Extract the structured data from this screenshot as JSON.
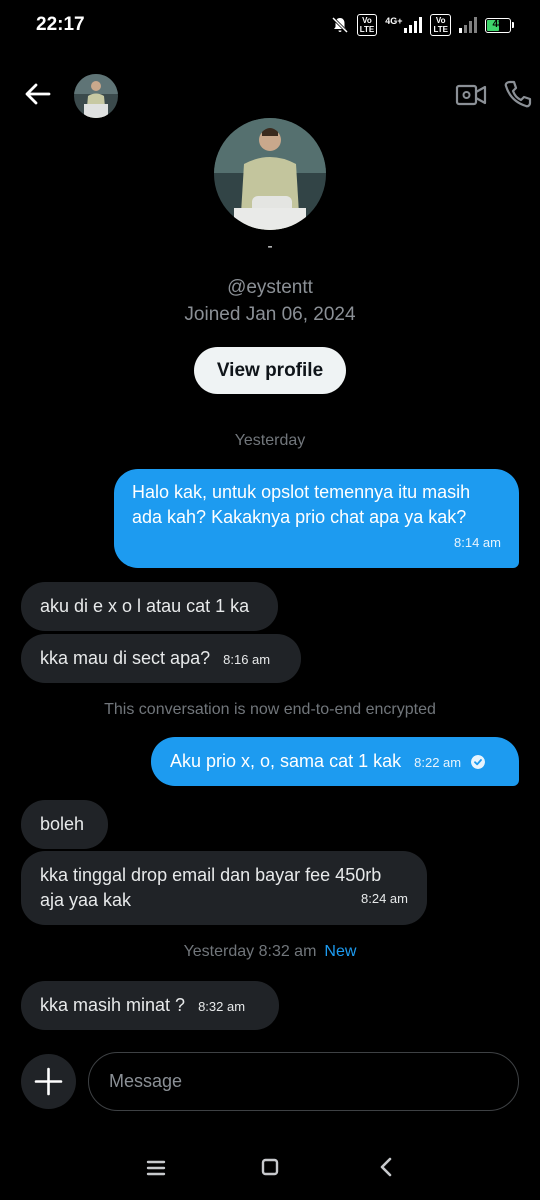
{
  "status_bar": {
    "time": "22:17",
    "network_label": "4G+",
    "volte_label": "Vo\nLTE",
    "battery_percent": "48",
    "battery_level": 0.48
  },
  "header": {
    "back_icon": "arrow-left-icon",
    "video_icon": "video-call-icon",
    "call_icon": "phone-icon"
  },
  "profile": {
    "dash": "-",
    "handle": "@eystentt",
    "joined": "Joined Jan 06, 2024",
    "view_profile_label": "View profile"
  },
  "conversation": {
    "sep_yesterday": "Yesterday",
    "messages": [
      {
        "direction": "out",
        "text": "Halo kak, untuk opslot temennya itu masih ada kah? Kakaknya prio chat apa ya kak?",
        "time": "8:14 am"
      },
      {
        "direction": "in",
        "text": "aku di e x o l atau cat 1 ka",
        "time": ""
      },
      {
        "direction": "in",
        "text": "kka mau di sect apa?",
        "time": "8:16 am"
      },
      {
        "direction": "out",
        "text": "Aku prio x, o, sama cat 1 kak",
        "time": "8:22 am",
        "read": true
      },
      {
        "direction": "in",
        "text": "boleh",
        "time": ""
      },
      {
        "direction": "in",
        "text": "kka tinggal drop email dan bayar fee 450rb aja yaa kak",
        "time": "8:24 am"
      },
      {
        "direction": "in",
        "text": "kka masih minat ?",
        "time": "8:32 am"
      }
    ],
    "encrypted_notice": "This conversation is now end-to-end encrypted",
    "new_sep_time": "Yesterday 8:32 am",
    "new_label": "New"
  },
  "composer": {
    "add_icon": "plus-icon",
    "placeholder": "Message"
  },
  "colors": {
    "accent": "#1d9bf0",
    "incoming_bubble": "#202327",
    "background": "#000000"
  }
}
